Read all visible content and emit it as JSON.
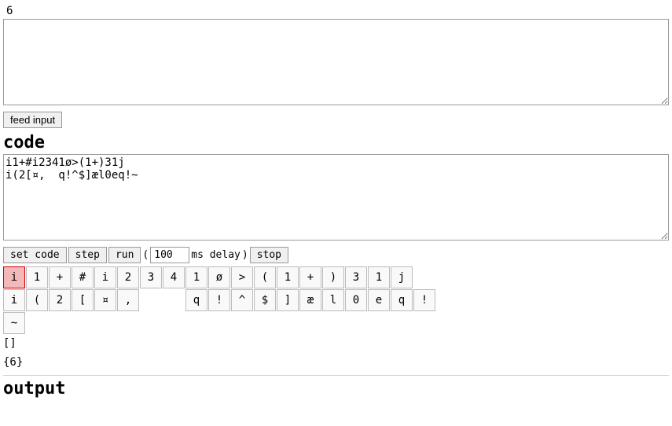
{
  "top_area": {
    "number": "6",
    "textarea_value": ""
  },
  "feed_input_button": "feed input",
  "code_label": "code",
  "code_textarea": "i1+#i2341ø>(1+)31j\ni(2[¤,  q!^$]æl0eq!~",
  "toolbar": {
    "set_code": "set code",
    "step": "step",
    "run": "run",
    "ms_delay_value": "100",
    "ms_delay_label": "ms delay",
    "stop": "stop"
  },
  "char_grid_row1": [
    "i",
    "1",
    "+",
    "#",
    "i",
    "2",
    "3",
    "4",
    "1",
    "ø",
    ">",
    "(",
    "1",
    "+",
    ")",
    "3",
    "1",
    "j",
    ""
  ],
  "char_grid_row2": [
    "i",
    "(",
    "2",
    "[",
    "¤",
    ",",
    "",
    "",
    "q",
    "!",
    "^",
    "$",
    "]",
    "æ",
    "l",
    "0",
    "e",
    "q",
    "!"
  ],
  "char_grid_row2_last": "~",
  "brackets_line": "[]",
  "result_line": "{6}",
  "output_label": "output",
  "highlighted_char": "i"
}
